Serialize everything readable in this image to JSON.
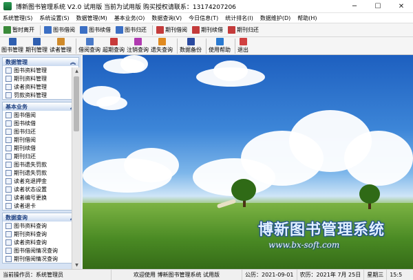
{
  "window": {
    "title": "博新图书管理系统 V2.0  试用版  当前为试用版  购买授权请联系：13174207206",
    "min": "─",
    "max": "☐",
    "close": "✕"
  },
  "menu": [
    "系统管理(S)",
    "系统设置(S)",
    "数据管理(M)",
    "基本业务(O)",
    "数据查询(V)",
    "今日信息(T)",
    "统计排名(I)",
    "数据维护(D)",
    "帮助(H)"
  ],
  "toolbar1": [
    {
      "label": "暂时离开",
      "icon": "exit-arrow-icon",
      "color": "#3a8a3a"
    },
    {
      "label": "图书借阅",
      "icon": "book-borrow-icon",
      "color": "#3b6fc4"
    },
    {
      "label": "图书续借",
      "icon": "book-renew-icon",
      "color": "#3b6fc4"
    },
    {
      "label": "图书归还",
      "icon": "book-return-icon",
      "color": "#3b6fc4"
    },
    {
      "label": "期刊借阅",
      "icon": "periodical-borrow-icon",
      "color": "#c43b3b"
    },
    {
      "label": "期刊续借",
      "icon": "periodical-renew-icon",
      "color": "#c43b3b"
    },
    {
      "label": "期刊归还",
      "icon": "periodical-return-icon",
      "color": "#c43b3b"
    }
  ],
  "toolbar2": [
    {
      "label": "图书管理",
      "icon": "book-manage-icon",
      "color": "#2f5fb0"
    },
    {
      "label": "期刊管理",
      "icon": "periodical-manage-icon",
      "color": "#2f5fb0"
    },
    {
      "label": "读者管理",
      "icon": "reader-manage-icon",
      "color": "#d08a2a"
    },
    {
      "label": "借阅查询",
      "icon": "borrow-query-icon",
      "color": "#4a7ac8"
    },
    {
      "label": "超期查询",
      "icon": "overdue-query-icon",
      "color": "#c83a3a"
    },
    {
      "label": "注销查询",
      "icon": "cancel-query-icon",
      "color": "#b03ab0"
    },
    {
      "label": "遗失查询",
      "icon": "lost-query-icon",
      "color": "#e08a20"
    },
    {
      "label": "数据备份",
      "icon": "backup-disk-icon",
      "color": "#2a4aa0"
    },
    {
      "label": "使用帮助",
      "icon": "help-info-icon",
      "color": "#2a7ad0"
    },
    {
      "label": "退出",
      "icon": "exit-door-icon",
      "color": "#d04040"
    }
  ],
  "sidebar": {
    "sections": [
      {
        "title": "数据管理",
        "items": [
          "图书资料管理",
          "期刊资料管理",
          "读者资料管理",
          "罚款资料管理"
        ]
      },
      {
        "title": "基本业务",
        "items": [
          "图书借阅",
          "图书续借",
          "图书归还",
          "期刊借阅",
          "期刊续借",
          "期刊归还",
          "图书遗失罚款",
          "期刊遗失罚款",
          "读者充退押金",
          "读者状态设置",
          "读者编号更换",
          "读者退卡"
        ]
      },
      {
        "title": "数据查询",
        "items": [
          "图书资料查询",
          "期刊资料查询",
          "读者资料查询",
          "图书借阅情况查询",
          "期刊借阅情况查询"
        ]
      }
    ],
    "collapse_glyph": "︽"
  },
  "banner": {
    "title": "博新图书管理系统",
    "url": "www.bx-soft.com"
  },
  "status": {
    "operator": "当前操作员：系统管理员",
    "welcome": "欢迎使用 博新图书管理系统 试用版",
    "gregorian": "公历：2021-09-01",
    "lunar": "农历：2021年 7月 25日",
    "weekday": "星期三",
    "time": "15:5"
  }
}
